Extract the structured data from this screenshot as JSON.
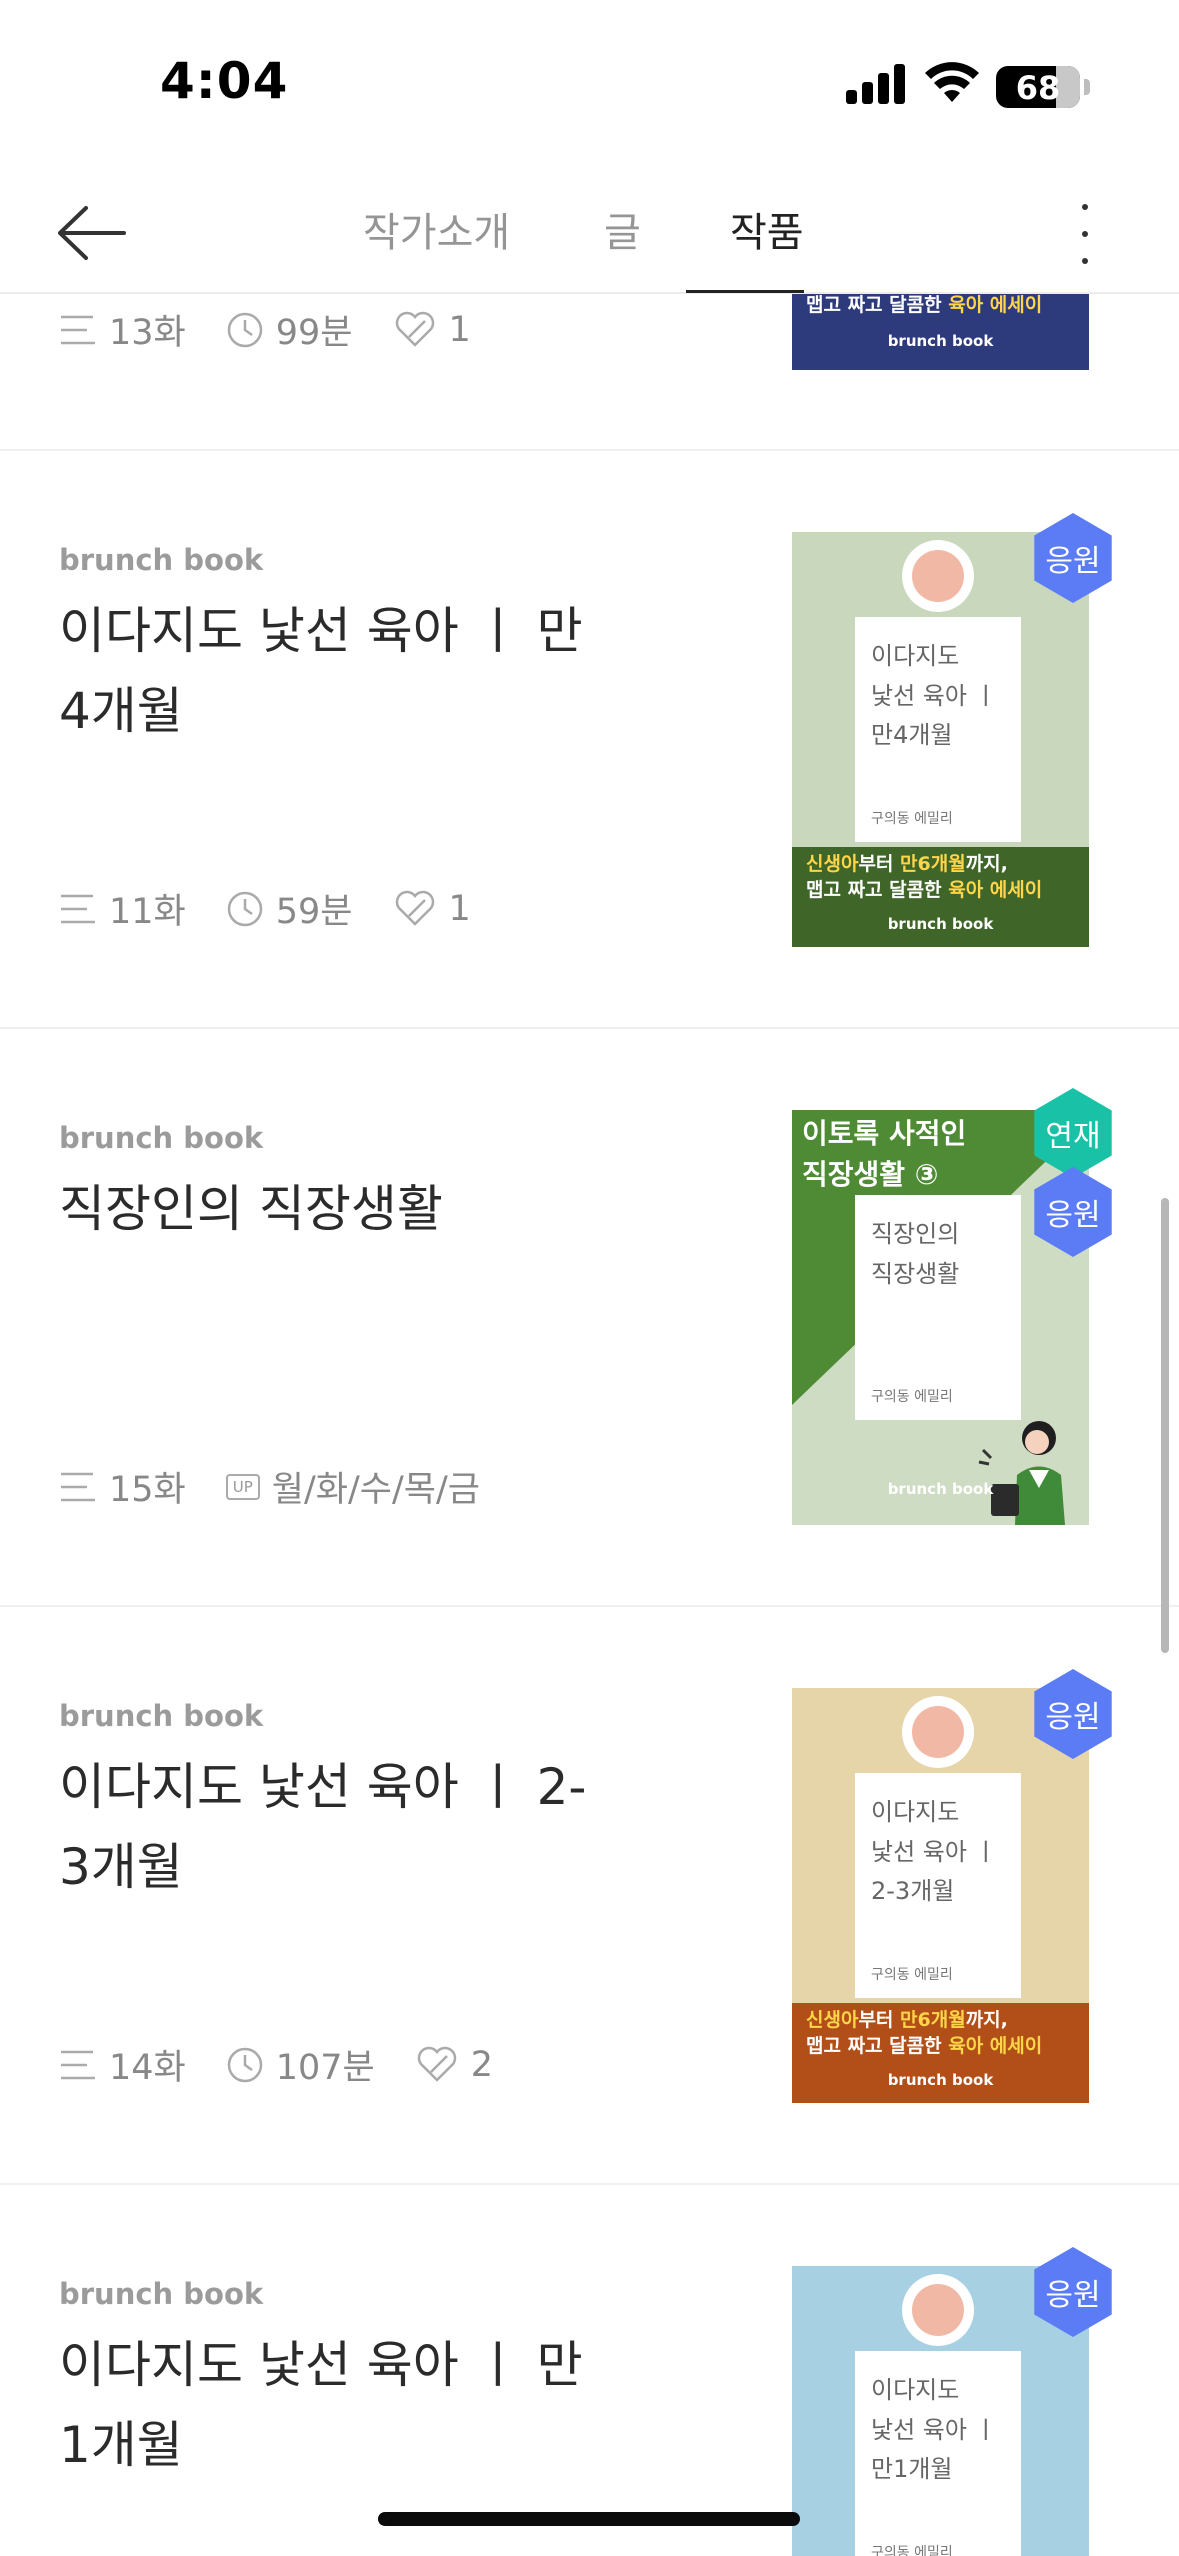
{
  "status_bar": {
    "time": "4:04",
    "battery_level": "68",
    "battery_fraction": 0.68
  },
  "header": {
    "tabs": [
      {
        "label": "작가소개",
        "active": false
      },
      {
        "label": "글",
        "active": false
      },
      {
        "label": "작품",
        "active": true
      }
    ]
  },
  "items": [
    {
      "kicker": "",
      "title": "",
      "episodes": "13화",
      "duration": "99분",
      "likes": "1",
      "cover": {
        "band_line1_prefix": "",
        "band_line2": [
          "맵고 짜고 달콤한 ",
          "육아 에세이"
        ],
        "brunch": "brunch book",
        "band_color": "#2d3a7c"
      }
    },
    {
      "kicker": "brunch book",
      "title": "이다지도 낯선 육아 ㅣ 만 4개월",
      "episodes": "11화",
      "duration": "59분",
      "likes": "1",
      "badge": "응원",
      "cover": {
        "bg": "#c9d8bc",
        "cover_title": "이다지도\n낯선 육아 ㅣ\n만4개월",
        "author": "구의동 에밀리",
        "band_line1": [
          "신생아",
          "부터 ",
          "만6개월",
          "까지,"
        ],
        "band_line2": [
          "맵고 짜고 달콤한 ",
          "육아 에세이"
        ],
        "brunch": "brunch book",
        "band_color": "#3f6628"
      }
    },
    {
      "kicker": "brunch book",
      "title": "직장인의 직장생활",
      "episodes": "15화",
      "schedule_icon": "UP",
      "schedule": "월/화/수/목/금",
      "badge_top": "연재",
      "badge": "응원",
      "cover": {
        "bg": "#cfdcc4",
        "headline1": "이토록 사적인",
        "headline2": "직장생활 ③",
        "cover_title": "직장인의\n직장생활",
        "author": "구의동 에밀리",
        "brunch": "brunch book",
        "accent": "#4f8a35"
      }
    },
    {
      "kicker": "brunch book",
      "title": "이다지도 낯선 육아 ㅣ 2-3개월",
      "episodes": "14화",
      "duration": "107분",
      "likes": "2",
      "badge": "응원",
      "cover": {
        "bg": "#e6d5a8",
        "cover_title": "이다지도\n낯선 육아 ㅣ\n2-3개월",
        "author": "구의동 에밀리",
        "band_line1": [
          "신생아",
          "부터 ",
          "만6개월",
          "까지,"
        ],
        "band_line2": [
          "맵고 짜고 달콤한 ",
          "육아 에세이"
        ],
        "brunch": "brunch book",
        "band_color": "#b24e18"
      }
    },
    {
      "kicker": "brunch book",
      "title": "이다지도 낯선 육아 ㅣ 만 1개월",
      "badge": "응원",
      "cover": {
        "bg": "#a7d1e2",
        "cover_title": "이다지도\n낯선 육아 ㅣ\n만1개월",
        "author": "구의동 에밀리"
      }
    }
  ]
}
